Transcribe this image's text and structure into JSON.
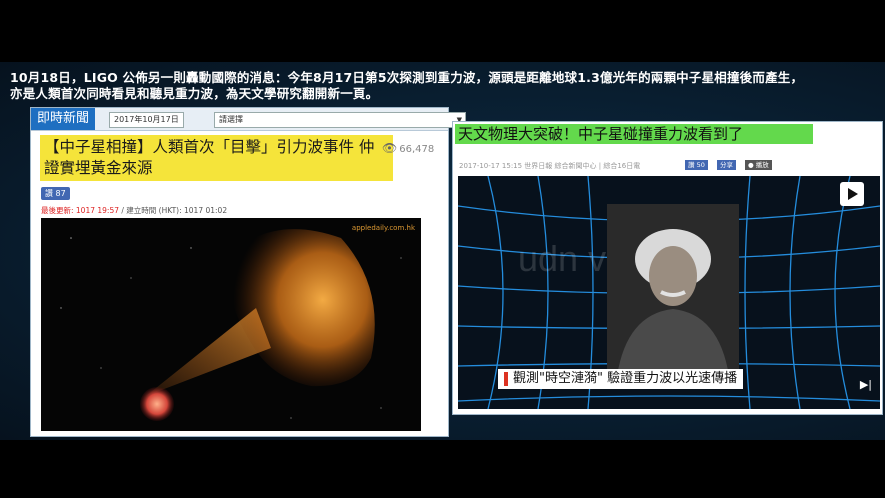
{
  "headline": {
    "line1": "10月18日，LIGO 公佈另一則轟動國際的消息：今年8月17日第5次探測到重力波，源頭是距離地球1.3億光年的兩顆中子星相撞後而產生，",
    "line2": "亦是人類首次同時看見和聽見重力波，為天文學研究翻開新一頁。"
  },
  "left_panel": {
    "brand": "即時新聞",
    "date": "2017年10月17日",
    "select_value": "請選擇",
    "title": "【中子星相撞】人類首次「目擊」引力波事件 仲證實埋黃金來源",
    "views": "66,478",
    "like_label": "讚 87",
    "updated_label": "最後更新: 1017 19:57",
    "created_label": "/ 建立時間 (HKT): 1017 01:02",
    "watermark": "appledaily.com.hk"
  },
  "right_panel": {
    "title": "天文物理大突破！中子星碰撞重力波看到了",
    "meta": "2017-10-17 15:15 世界日報 綜合新聞中心 | 綜合16日電",
    "like_label": "讚 50",
    "share_label": "分享",
    "more_label": "● 播放",
    "video_watermark": "udn video",
    "caption": "觀測\"時空漣漪\" 驗證重力波以光速傳播"
  },
  "colors": {
    "left_title_bg": "#f5e43a",
    "right_title_bg": "#63d94c",
    "brand_blue": "#1e6fc1",
    "grid_blue": "#2aa3ff"
  }
}
